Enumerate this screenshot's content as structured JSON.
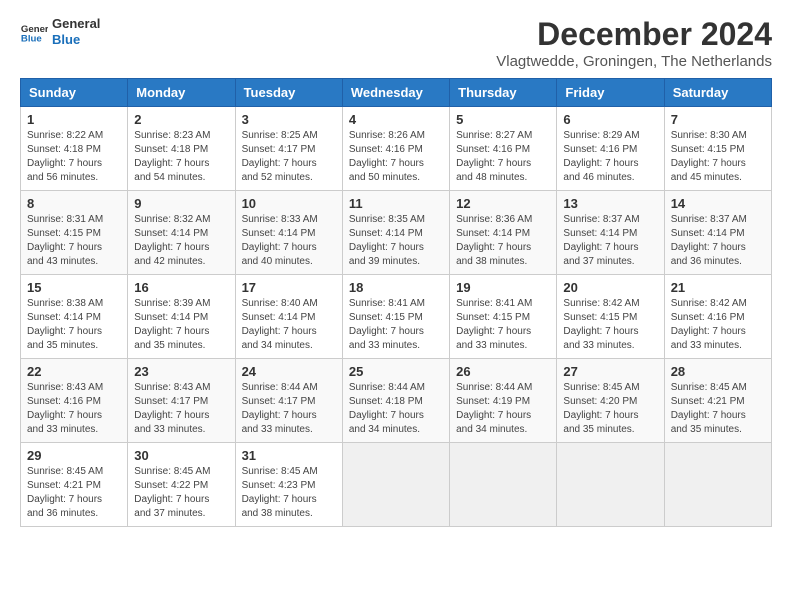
{
  "logo": {
    "line1": "General",
    "line2": "Blue"
  },
  "title": "December 2024",
  "location": "Vlagtwedde, Groningen, The Netherlands",
  "days_of_week": [
    "Sunday",
    "Monday",
    "Tuesday",
    "Wednesday",
    "Thursday",
    "Friday",
    "Saturday"
  ],
  "weeks": [
    [
      {
        "day": "1",
        "sunrise": "8:22 AM",
        "sunset": "4:18 PM",
        "daylight": "7 hours and 56 minutes."
      },
      {
        "day": "2",
        "sunrise": "8:23 AM",
        "sunset": "4:18 PM",
        "daylight": "7 hours and 54 minutes."
      },
      {
        "day": "3",
        "sunrise": "8:25 AM",
        "sunset": "4:17 PM",
        "daylight": "7 hours and 52 minutes."
      },
      {
        "day": "4",
        "sunrise": "8:26 AM",
        "sunset": "4:16 PM",
        "daylight": "7 hours and 50 minutes."
      },
      {
        "day": "5",
        "sunrise": "8:27 AM",
        "sunset": "4:16 PM",
        "daylight": "7 hours and 48 minutes."
      },
      {
        "day": "6",
        "sunrise": "8:29 AM",
        "sunset": "4:16 PM",
        "daylight": "7 hours and 46 minutes."
      },
      {
        "day": "7",
        "sunrise": "8:30 AM",
        "sunset": "4:15 PM",
        "daylight": "7 hours and 45 minutes."
      }
    ],
    [
      {
        "day": "8",
        "sunrise": "8:31 AM",
        "sunset": "4:15 PM",
        "daylight": "7 hours and 43 minutes."
      },
      {
        "day": "9",
        "sunrise": "8:32 AM",
        "sunset": "4:14 PM",
        "daylight": "7 hours and 42 minutes."
      },
      {
        "day": "10",
        "sunrise": "8:33 AM",
        "sunset": "4:14 PM",
        "daylight": "7 hours and 40 minutes."
      },
      {
        "day": "11",
        "sunrise": "8:35 AM",
        "sunset": "4:14 PM",
        "daylight": "7 hours and 39 minutes."
      },
      {
        "day": "12",
        "sunrise": "8:36 AM",
        "sunset": "4:14 PM",
        "daylight": "7 hours and 38 minutes."
      },
      {
        "day": "13",
        "sunrise": "8:37 AM",
        "sunset": "4:14 PM",
        "daylight": "7 hours and 37 minutes."
      },
      {
        "day": "14",
        "sunrise": "8:37 AM",
        "sunset": "4:14 PM",
        "daylight": "7 hours and 36 minutes."
      }
    ],
    [
      {
        "day": "15",
        "sunrise": "8:38 AM",
        "sunset": "4:14 PM",
        "daylight": "7 hours and 35 minutes."
      },
      {
        "day": "16",
        "sunrise": "8:39 AM",
        "sunset": "4:14 PM",
        "daylight": "7 hours and 35 minutes."
      },
      {
        "day": "17",
        "sunrise": "8:40 AM",
        "sunset": "4:14 PM",
        "daylight": "7 hours and 34 minutes."
      },
      {
        "day": "18",
        "sunrise": "8:41 AM",
        "sunset": "4:15 PM",
        "daylight": "7 hours and 33 minutes."
      },
      {
        "day": "19",
        "sunrise": "8:41 AM",
        "sunset": "4:15 PM",
        "daylight": "7 hours and 33 minutes."
      },
      {
        "day": "20",
        "sunrise": "8:42 AM",
        "sunset": "4:15 PM",
        "daylight": "7 hours and 33 minutes."
      },
      {
        "day": "21",
        "sunrise": "8:42 AM",
        "sunset": "4:16 PM",
        "daylight": "7 hours and 33 minutes."
      }
    ],
    [
      {
        "day": "22",
        "sunrise": "8:43 AM",
        "sunset": "4:16 PM",
        "daylight": "7 hours and 33 minutes."
      },
      {
        "day": "23",
        "sunrise": "8:43 AM",
        "sunset": "4:17 PM",
        "daylight": "7 hours and 33 minutes."
      },
      {
        "day": "24",
        "sunrise": "8:44 AM",
        "sunset": "4:17 PM",
        "daylight": "7 hours and 33 minutes."
      },
      {
        "day": "25",
        "sunrise": "8:44 AM",
        "sunset": "4:18 PM",
        "daylight": "7 hours and 34 minutes."
      },
      {
        "day": "26",
        "sunrise": "8:44 AM",
        "sunset": "4:19 PM",
        "daylight": "7 hours and 34 minutes."
      },
      {
        "day": "27",
        "sunrise": "8:45 AM",
        "sunset": "4:20 PM",
        "daylight": "7 hours and 35 minutes."
      },
      {
        "day": "28",
        "sunrise": "8:45 AM",
        "sunset": "4:21 PM",
        "daylight": "7 hours and 35 minutes."
      }
    ],
    [
      {
        "day": "29",
        "sunrise": "8:45 AM",
        "sunset": "4:21 PM",
        "daylight": "7 hours and 36 minutes."
      },
      {
        "day": "30",
        "sunrise": "8:45 AM",
        "sunset": "4:22 PM",
        "daylight": "7 hours and 37 minutes."
      },
      {
        "day": "31",
        "sunrise": "8:45 AM",
        "sunset": "4:23 PM",
        "daylight": "7 hours and 38 minutes."
      },
      null,
      null,
      null,
      null
    ]
  ]
}
